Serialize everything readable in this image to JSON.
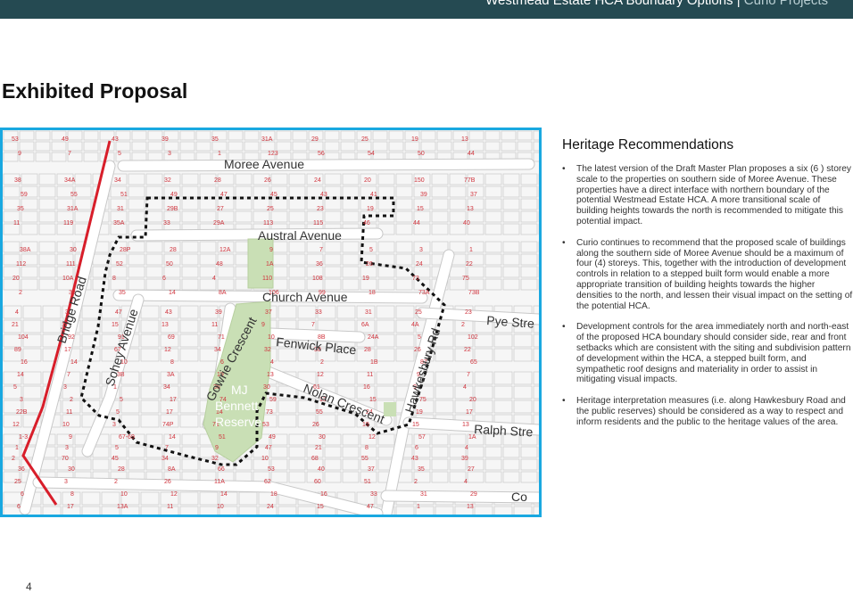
{
  "header": {
    "title": "Westmead Estate HCA Boundary Options",
    "separator": "|",
    "brand": "Curio Projects"
  },
  "page_title": "Exhibited Proposal",
  "map": {
    "streets": {
      "moree": "Moree Avenue",
      "austral": "Austral Avenue",
      "church": "Church Avenue",
      "fenwick": "Fenwick Place",
      "nolan": "Nolan Crescent",
      "hawkesbury": "Hawkesbury Rd",
      "bridge": "Bridge Road",
      "sohey": "Sohey Avenue",
      "gowrie": "Gowrie Crescent",
      "pye": "Pye Stre",
      "ralph": "Ralph Stre",
      "cor": "Co"
    },
    "reserve": {
      "line1": "MJ",
      "line2": "Bennett",
      "line3": "Reserve"
    },
    "lot_numbers": [
      "53",
      "49",
      "43",
      "39",
      "35",
      "31A",
      "29",
      "25",
      "19",
      "13",
      "9",
      "7",
      "5",
      "3",
      "1",
      "123",
      "56",
      "54",
      "50",
      "44",
      "38",
      "34A",
      "34",
      "32",
      "28",
      "26",
      "24",
      "20",
      "150",
      "77B",
      "59",
      "55",
      "51",
      "49",
      "47",
      "45",
      "43",
      "41",
      "39",
      "37",
      "35",
      "31A",
      "31",
      "29B",
      "27",
      "25",
      "23",
      "19",
      "15",
      "13",
      "11",
      "119",
      "35A",
      "33",
      "29A",
      "113",
      "115",
      "46",
      "44",
      "40",
      "38A",
      "30",
      "28P",
      "28",
      "12A",
      "9",
      "7",
      "5",
      "3",
      "1",
      "112",
      "111",
      "52",
      "50",
      "48",
      "1A",
      "36",
      "26",
      "24",
      "22",
      "20",
      "10A",
      "8",
      "6",
      "4",
      "110",
      "108",
      "19",
      "73",
      "75",
      "2",
      "38",
      "35",
      "14",
      "8A",
      "106",
      "99",
      "18",
      "73A",
      "73B",
      "4",
      "3",
      "47",
      "43",
      "39",
      "37",
      "33",
      "31",
      "25",
      "23",
      "21",
      "17",
      "15",
      "13",
      "11",
      "9",
      "7",
      "6A",
      "4A",
      "2",
      "104",
      "92",
      "91",
      "69",
      "71",
      "10",
      "8B",
      "24A",
      "5",
      "102",
      "89",
      "17",
      "67",
      "12",
      "34",
      "32",
      "30",
      "28",
      "26",
      "22",
      "16",
      "14",
      "10",
      "8",
      "6",
      "4",
      "2",
      "1B",
      "87",
      "65",
      "14",
      "7",
      "3B",
      "3A",
      "19",
      "13",
      "12",
      "11",
      "9",
      "7",
      "5",
      "3",
      "1",
      "34",
      "36",
      "30",
      "61",
      "16",
      "9",
      "4",
      "3",
      "2",
      "5",
      "17",
      "74",
      "59",
      "13",
      "15",
      "75",
      "20",
      "22B",
      "11",
      "5",
      "17",
      "14",
      "73",
      "55",
      "24",
      "19",
      "17",
      "12",
      "10",
      "3",
      "74P",
      "71",
      "53",
      "26",
      "19",
      "15",
      "13",
      "1-3",
      "9",
      "67-69",
      "14",
      "51",
      "49",
      "30",
      "12",
      "57",
      "1A",
      "1",
      "3",
      "5",
      "7",
      "9",
      "47",
      "21",
      "8",
      "6",
      "4",
      "2",
      "70",
      "45",
      "34",
      "32",
      "10",
      "68",
      "55",
      "43",
      "39",
      "36",
      "30",
      "28",
      "8A",
      "66",
      "53",
      "40",
      "37",
      "35",
      "27",
      "25",
      "3",
      "2",
      "26",
      "11A",
      "62",
      "60",
      "51",
      "2",
      "4",
      "6",
      "8",
      "10",
      "12",
      "14",
      "18",
      "16",
      "33",
      "31",
      "29",
      "6",
      "17",
      "13A",
      "11",
      "10",
      "24",
      "15",
      "47",
      "1",
      "13"
    ]
  },
  "panel": {
    "heading": "Heritage Recommendations",
    "bullets": [
      "The latest version of the Draft Master Plan proposes a six (6 ) storey scale to the properties on southern side of Moree Avenue. These properties have a direct interface with northern boundary of the potential Westmead Estate HCA. A more transitional scale of building heights towards the north is recommended to mitigate this potential impact.",
      "Curio continues to recommend that the proposed scale of buildings along the southern side of Moree Avenue should be a maximum of four (4) storeys. This, together with the introduction of development controls in relation to a stepped built form would enable a more appropriate transition of building heights towards the higher densities to the north, and lessen their visual impact on the setting of the potential HCA.",
      "Development controls for the area immediately north and north-east of the proposed HCA boundary should consider side, rear and front setbacks which are consistent with the siting and subdivision pattern of development within the HCA, a stepped built form, and sympathetic roof designs and materiality in order to assist in mitigating visual impacts.",
      "Heritage interpretation measures (i.e. along Hawkesbury Road and the public reserves) should be considered as a way to respect and inform residents and the public to the heritage values of the area."
    ]
  },
  "page_number": "4",
  "colors": {
    "header_bg": "#254a52",
    "frame": "#19a8e0",
    "boundary_red": "#d81e2a",
    "park": "#c9dfb5",
    "lot_number": "#d0343d"
  }
}
